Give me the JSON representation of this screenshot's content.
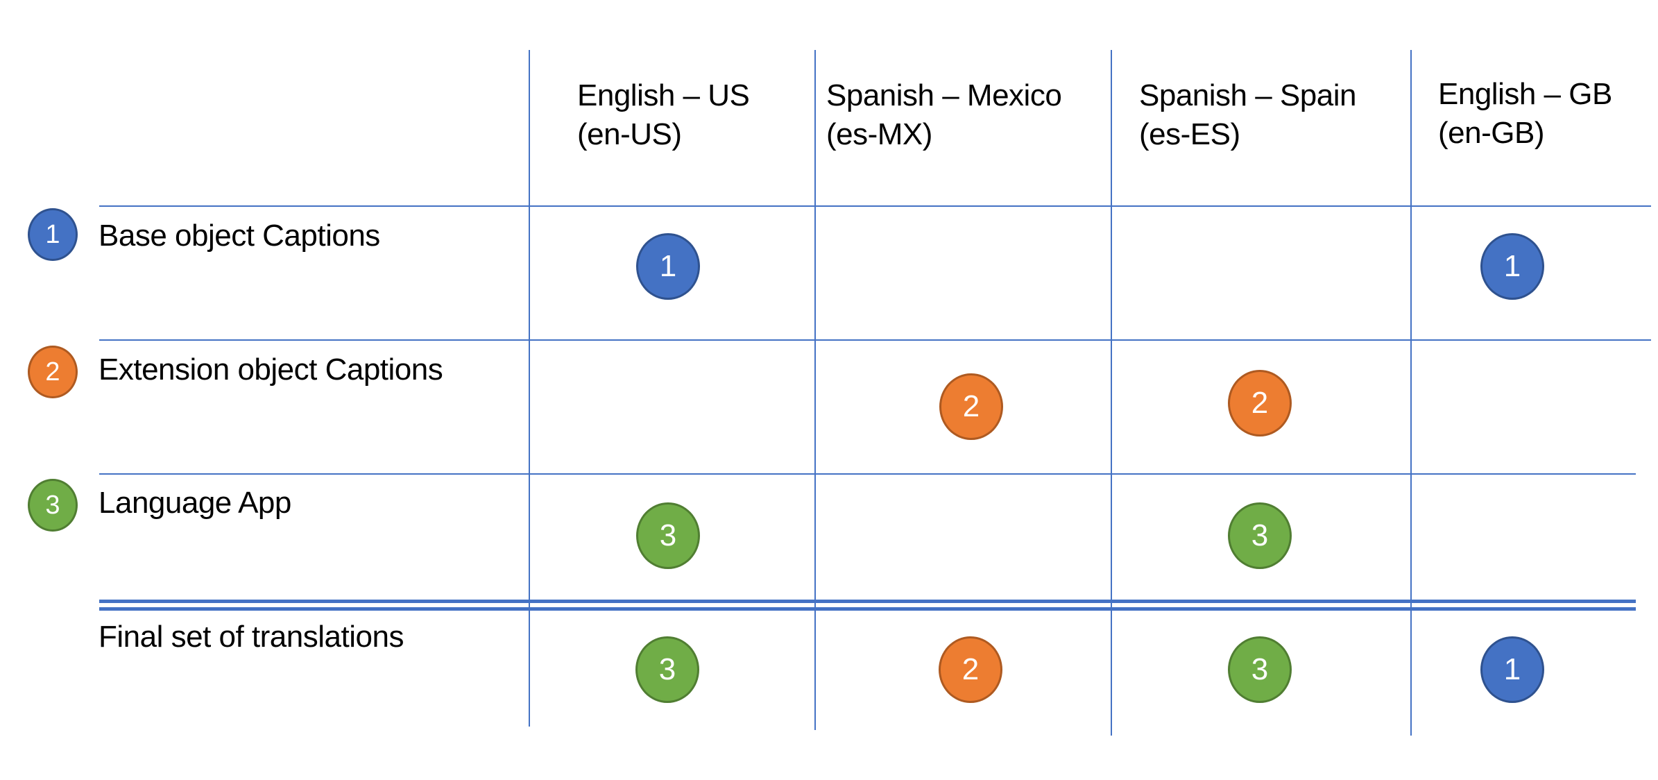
{
  "colors": {
    "grid": "#4472C4",
    "source_1": "#4472C4",
    "source_2": "#ED7D31",
    "source_3": "#70AD47"
  },
  "columns": [
    {
      "name": "English – US",
      "code": "(en-US)"
    },
    {
      "name": "Spanish – Mexico",
      "code": "(es-MX)"
    },
    {
      "name": "Spanish – Spain",
      "code": "(es-ES)"
    },
    {
      "name": "English – GB",
      "code": "(en-GB)"
    }
  ],
  "rows": [
    {
      "badge": "1",
      "label": "Base object Captions",
      "cells": [
        "1",
        "",
        "",
        "1"
      ]
    },
    {
      "badge": "2",
      "label": "Extension object Captions",
      "cells": [
        "",
        "2",
        "2",
        ""
      ]
    },
    {
      "badge": "3",
      "label": "Language App",
      "cells": [
        "3",
        "",
        "3",
        ""
      ]
    }
  ],
  "final": {
    "label": "Final set of translations",
    "cells": [
      "3",
      "2",
      "3",
      "1"
    ]
  }
}
